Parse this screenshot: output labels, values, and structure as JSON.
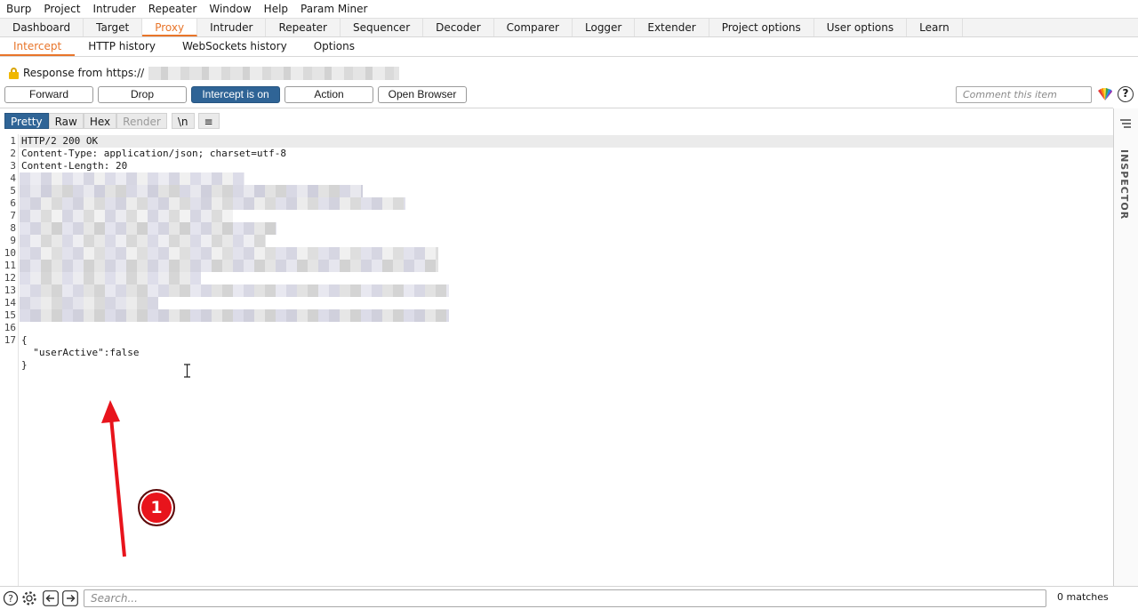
{
  "menu": [
    "Burp",
    "Project",
    "Intruder",
    "Repeater",
    "Window",
    "Help",
    "Param Miner"
  ],
  "main_tabs": [
    "Dashboard",
    "Target",
    "Proxy",
    "Intruder",
    "Repeater",
    "Sequencer",
    "Decoder",
    "Comparer",
    "Logger",
    "Extender",
    "Project options",
    "User options",
    "Learn"
  ],
  "active_main_tab": "Proxy",
  "sub_tabs": [
    "Intercept",
    "HTTP history",
    "WebSockets history",
    "Options"
  ],
  "active_sub_tab": "Intercept",
  "response_label": "Response from https://",
  "buttons": {
    "forward": "Forward",
    "drop": "Drop",
    "intercept": "Intercept is on",
    "action": "Action",
    "open_browser": "Open Browser"
  },
  "comment_placeholder": "Comment this item",
  "help_glyph": "?",
  "view_tabs": [
    "Pretty",
    "Raw",
    "Hex",
    "Render"
  ],
  "active_view": "Pretty",
  "newline_toggle": "\\n",
  "menu_glyph": "≡",
  "line_numbers": [
    "1",
    "2",
    "3",
    "4",
    "5",
    "6",
    "7",
    "8",
    "9",
    "10",
    "11",
    "12",
    "13",
    "14",
    "15",
    "16",
    "17"
  ],
  "code_lines": {
    "l1": "HTTP/2 200 OK",
    "l2": "Content-Type: application/json; charset=utf-8",
    "l3": "Content-Length: 20",
    "l17": "{",
    "l18": "  \"userActive\":false",
    "l19": "}"
  },
  "inspector_label": "INSPECTOR",
  "annotation_number": "1",
  "search_placeholder": "Search...",
  "matches": "0 matches",
  "colors": {
    "accent": "#e8752a",
    "primary_button": "#2f6496",
    "annotation_red": "#e8141c"
  }
}
